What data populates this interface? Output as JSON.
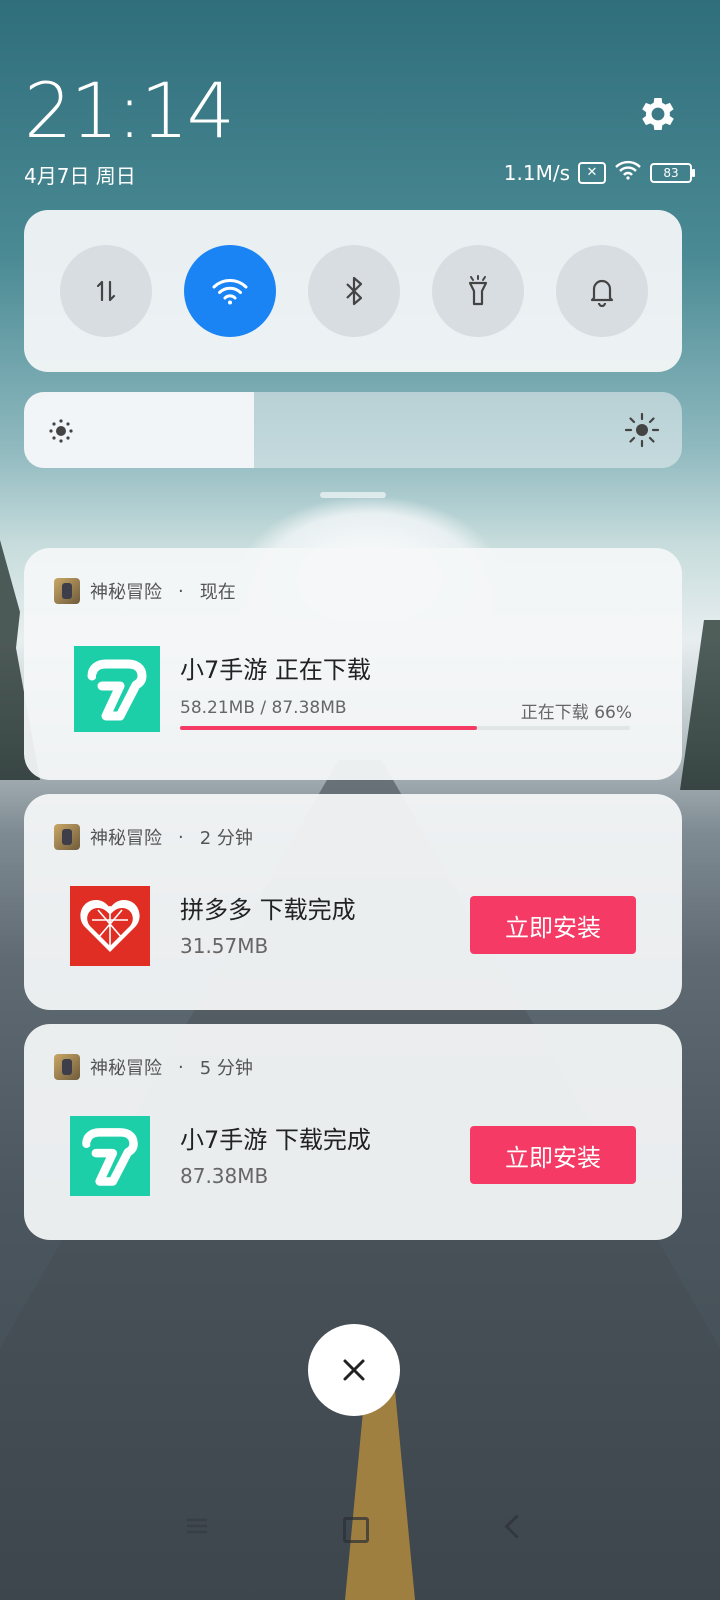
{
  "status_bar": {
    "time": "21:14",
    "date": "4月7日 周日",
    "net_speed": "1.1M/s",
    "sim_icon": "no-sim-icon",
    "battery": "83"
  },
  "quick_toggles": [
    {
      "name": "mobile-data",
      "icon": "data-arrows-icon",
      "on": false
    },
    {
      "name": "wifi",
      "icon": "wifi-icon",
      "on": true
    },
    {
      "name": "bluetooth",
      "icon": "bluetooth-icon",
      "on": false
    },
    {
      "name": "flashlight",
      "icon": "flashlight-icon",
      "on": false
    },
    {
      "name": "sound",
      "icon": "bell-icon",
      "on": false
    }
  ],
  "brightness": {
    "level_fraction": 0.35
  },
  "notifications": [
    {
      "app": "神秘冒险",
      "time": "现在",
      "title": "小7手游  正在下载",
      "progress_text": "58.21MB / 87.38MB",
      "progress_status": "正在下载 66%",
      "progress": 0.66
    },
    {
      "app": "神秘冒险",
      "time": "2 分钟",
      "title": "拼多多  下载完成",
      "size": "31.57MB",
      "button": "立即安装"
    },
    {
      "app": "神秘冒险",
      "time": "5 分钟",
      "title": "小7手游  下载完成",
      "size": "87.38MB",
      "button": "立即安装"
    }
  ],
  "colors": {
    "accent_blue": "#1a84f5",
    "install_red": "#f53b65",
    "app7_green": "#1dcfa9",
    "pdd_red": "#e02e24"
  }
}
